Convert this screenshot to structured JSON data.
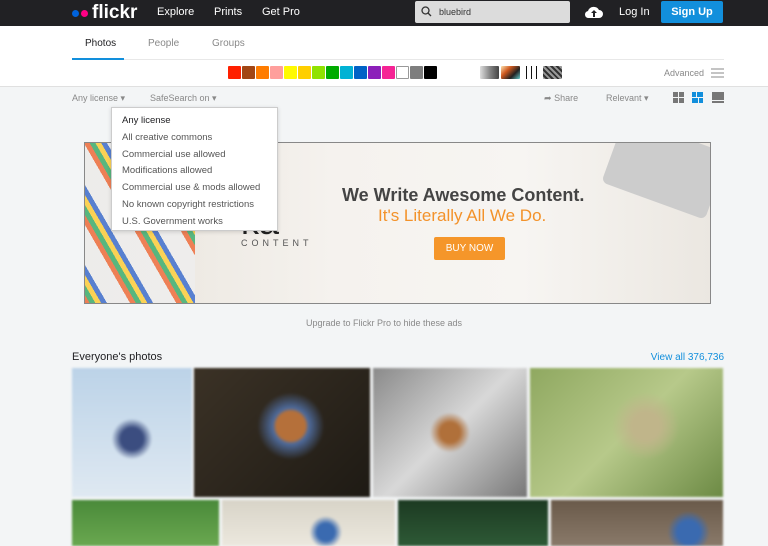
{
  "header": {
    "logo": "flickr",
    "logo_colors": [
      "#0063dc",
      "#ff0084"
    ],
    "nav": [
      "Explore",
      "Prints",
      "Get Pro"
    ],
    "search_value": "bluebird",
    "login": "Log In",
    "signup": "Sign Up"
  },
  "tabs": [
    {
      "label": "Photos",
      "active": true
    },
    {
      "label": "People"
    },
    {
      "label": "Groups"
    }
  ],
  "colors": [
    "#ff2000",
    "#a24615",
    "#ff7c00",
    "#ff9f9c",
    "#fffa00",
    "#ffcf00",
    "#90e200",
    "#00ab00",
    "#00b2d4",
    "#0062c6",
    "#8c20ba",
    "#f52394",
    "#ffffff",
    "#7e7e7e",
    "#000000"
  ],
  "advanced": "Advanced",
  "filters": {
    "license": "Any license",
    "safesearch": "SafeSearch on",
    "share": "Share",
    "sort": "Relevant"
  },
  "license_menu": [
    "Any license",
    "All creative commons",
    "Commercial use allowed",
    "Modifications allowed",
    "Commercial use & mods allowed",
    "No known copyright restrictions",
    "U.S. Government works"
  ],
  "ad": {
    "logo": "ka",
    "logo_sub": "CONTENT",
    "headline": "We Write Awesome Content.",
    "tagline": "It's Literally All We Do.",
    "button": "BUY NOW"
  },
  "upgrade": "Upgrade to Flickr Pro to hide these ads",
  "section": {
    "title": "Everyone's photos",
    "view_all": "View all 376,736"
  }
}
